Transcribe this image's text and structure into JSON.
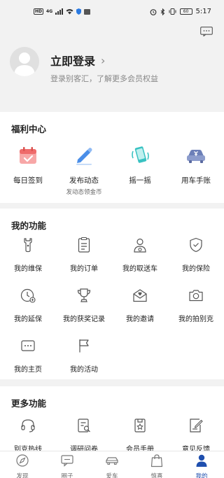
{
  "statusbar": {
    "hd": "HD",
    "network": "4G",
    "battery": "60",
    "time": "5:17"
  },
  "header": {
    "login_title": "立即登录",
    "login_chevron": "›",
    "login_subtitle": "登录别客汇，了解更多会员权益"
  },
  "welfare": {
    "title": "福利中心",
    "items": [
      {
        "label": "每日签到",
        "icon": "calendar-check-icon"
      },
      {
        "label": "发布动态",
        "sub": "发动态领金币",
        "icon": "pen-icon"
      },
      {
        "label": "摇一摇",
        "icon": "shake-phone-icon"
      },
      {
        "label": "用车手账",
        "icon": "car-ledger-icon"
      }
    ]
  },
  "functions": {
    "title": "我的功能",
    "items": [
      {
        "label": "我的维保",
        "icon": "wrench-icon"
      },
      {
        "label": "我的订单",
        "icon": "order-list-icon"
      },
      {
        "label": "我的取送车",
        "icon": "driver-icon"
      },
      {
        "label": "我的保险",
        "icon": "shield-icon"
      },
      {
        "label": "我的延保",
        "icon": "extended-warranty-icon"
      },
      {
        "label": "我的获奖记录",
        "icon": "trophy-icon"
      },
      {
        "label": "我的邀请",
        "icon": "invite-icon"
      },
      {
        "label": "我的拍别克",
        "icon": "camera-icon"
      },
      {
        "label": "我的主页",
        "icon": "homepage-icon"
      },
      {
        "label": "我的活动",
        "icon": "flag-icon"
      }
    ]
  },
  "more": {
    "title": "更多功能",
    "items": [
      {
        "label": "别克热线",
        "icon": "headset-icon"
      },
      {
        "label": "调研问卷",
        "icon": "survey-icon"
      },
      {
        "label": "会员手册",
        "icon": "member-handbook-icon"
      },
      {
        "label": "意见反馈",
        "icon": "feedback-icon"
      }
    ]
  },
  "tabbar": {
    "active_color": "#1f4fae",
    "items": [
      {
        "label": "发现",
        "icon": "compass-icon"
      },
      {
        "label": "圈子",
        "icon": "chat-icon"
      },
      {
        "label": "爱车",
        "icon": "car-icon"
      },
      {
        "label": "惊喜",
        "icon": "gift-bag-icon"
      },
      {
        "label": "我的",
        "icon": "person-icon"
      }
    ]
  }
}
